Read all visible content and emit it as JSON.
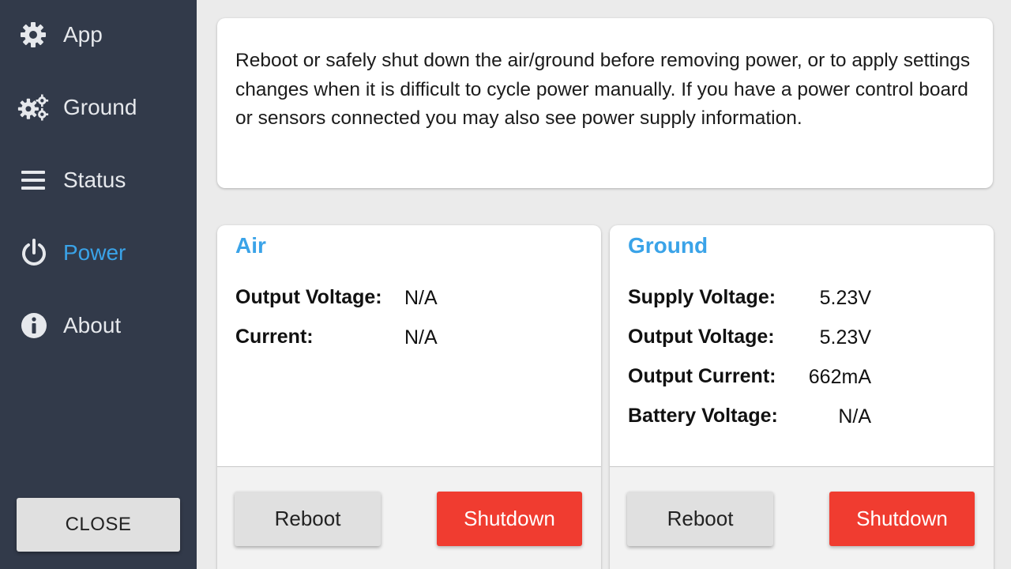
{
  "sidebar": {
    "items": [
      {
        "label": "App",
        "icon": "gear-icon",
        "active": false
      },
      {
        "label": "Ground",
        "icon": "gears-icon",
        "active": false
      },
      {
        "label": "Status",
        "icon": "menu-icon",
        "active": false
      },
      {
        "label": "Power",
        "icon": "power-icon",
        "active": true
      },
      {
        "label": "About",
        "icon": "info-icon",
        "active": false
      }
    ],
    "close_label": "CLOSE"
  },
  "info": {
    "text": "Reboot or safely shut down the air/ground before removing power, or to apply settings changes when it is difficult to cycle power manually. If you have a power control board or sensors connected you may also see power supply information."
  },
  "air": {
    "title": "Air",
    "stats": [
      {
        "label": "Output Voltage:",
        "value": "N/A"
      },
      {
        "label": "Current:",
        "value": "N/A"
      }
    ],
    "reboot_label": "Reboot",
    "shutdown_label": "Shutdown"
  },
  "ground": {
    "title": "Ground",
    "stats": [
      {
        "label": "Supply Voltage:",
        "value": "5.23V"
      },
      {
        "label": "Output Voltage:",
        "value": "5.23V"
      },
      {
        "label": "Output Current:",
        "value": "662mA"
      },
      {
        "label": "Battery Voltage:",
        "value": "N/A"
      }
    ],
    "reboot_label": "Reboot",
    "shutdown_label": "Shutdown"
  },
  "colors": {
    "sidebar_bg": "#323a4a",
    "accent": "#3aa3e8",
    "danger": "#f03c30",
    "page_bg": "#ebebeb"
  }
}
